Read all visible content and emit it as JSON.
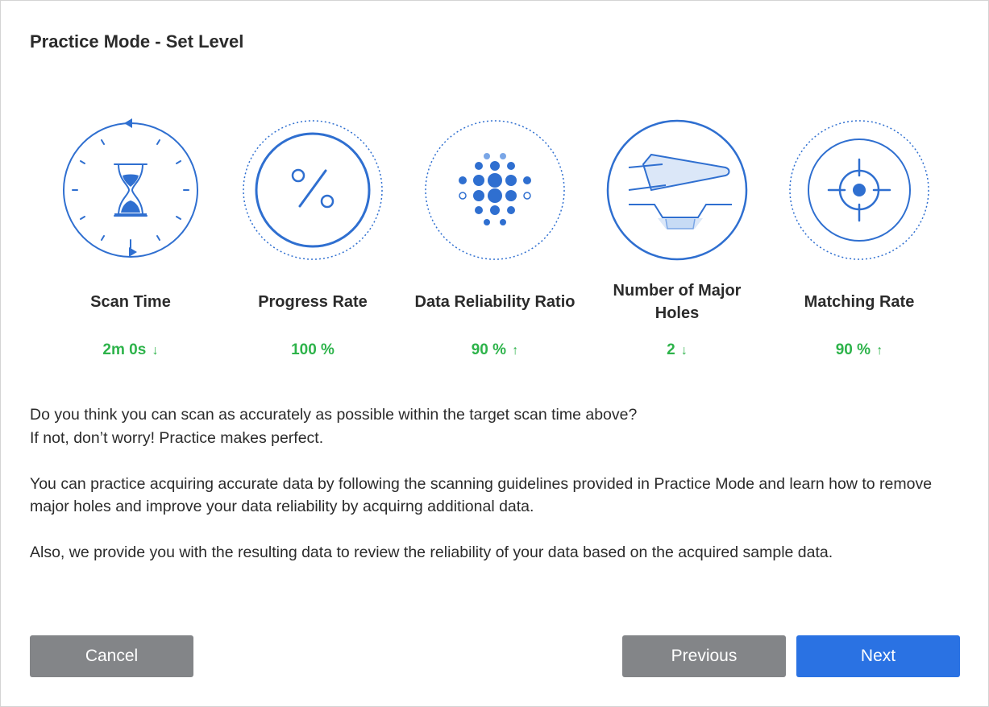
{
  "dialog": {
    "title": "Practice Mode - Set Level"
  },
  "metrics": [
    {
      "label": "Scan Time",
      "value": "2m 0s",
      "trend": "↓",
      "icon": "hourglass-timer-icon"
    },
    {
      "label": "Progress Rate",
      "value": "100 %",
      "trend": "",
      "icon": "percent-icon"
    },
    {
      "label": "Data Reliability Ratio",
      "value": "90 %",
      "trend": "↑",
      "icon": "dot-cluster-icon"
    },
    {
      "label": "Number of Major Holes",
      "value": "2",
      "trend": "↓",
      "icon": "scanner-hole-icon"
    },
    {
      "label": "Matching Rate",
      "value": "90 %",
      "trend": "↑",
      "icon": "crosshair-target-icon"
    }
  ],
  "paragraphs": [
    {
      "line1": "Do you think you can scan as accurately as possible within the target scan time above?",
      "line2": "If not, don’t worry! Practice makes perfect."
    },
    {
      "text": "You can practice acquiring accurate data by following the scanning guidelines provided in Practice Mode and learn how to remove major holes and improve your data reliability by acquirng additional data."
    },
    {
      "text": "Also, we provide you with the resulting data to review the reliability of your data based on the acquired sample data."
    }
  ],
  "buttons": {
    "cancel": "Cancel",
    "previous": "Previous",
    "next": "Next"
  },
  "colors": {
    "accent": "#2a72e3",
    "icon": "#2f6fd0",
    "success": "#2db34a",
    "button_gray": "#838588"
  }
}
